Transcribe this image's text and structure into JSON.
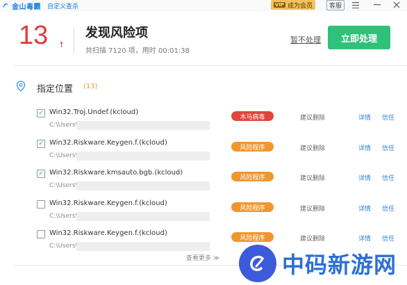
{
  "header": {
    "app_name": "金山毒霸",
    "app_subtitle": "自定义查杀",
    "vip_tag": "VIP",
    "vip_label": "成为会员",
    "service_label": "客服"
  },
  "summary": {
    "count": "13",
    "arrow": "↑",
    "title": "发现风险项",
    "subtitle": "共扫描 7120 项，用时 00:01:38",
    "ignore_label": "暂不处理",
    "fix_label": "立即处理"
  },
  "section": {
    "title": "指定位置",
    "count": "(13)"
  },
  "items": [
    {
      "name": "Win32.Troj.Undef.(kcloud)",
      "path": "C:\\Users\\",
      "badge": "木马病毒",
      "badge_color": "#e0453c",
      "advice": "建议删除",
      "detail": "详情",
      "trust": "信任",
      "checked": "✓"
    },
    {
      "name": "Win32.Riskware.Keygen.f.(kcloud)",
      "path": "C:\\Users\\",
      "badge": "风险程序",
      "badge_color": "#f0962e",
      "advice": "建议删除",
      "detail": "详情",
      "trust": "信任",
      "checked": "✓"
    },
    {
      "name": "Win32.Riskware.kmsauto.bgb.(kcloud)",
      "path": "C:\\Users\\",
      "badge": "风险程序",
      "badge_color": "#f0962e",
      "advice": "建议删除",
      "detail": "详情",
      "trust": "信任",
      "checked": "✓"
    },
    {
      "name": "Win32.Riskware.Keygen.f.(kcloud)",
      "path": "C:\\Users\\",
      "badge": "风险程序",
      "badge_color": "#f0962e",
      "advice": "建议删除",
      "detail": "详情",
      "trust": "信任",
      "checked": ""
    },
    {
      "name": "Win32.Riskware.Keygen.f.(kcloud)",
      "path": "C:\\Users\\",
      "badge": "风险程序",
      "badge_color": "#f0962e",
      "advice": "建议删除",
      "detail": "详情",
      "trust": "信任",
      "checked": ""
    }
  ],
  "footer": {
    "more_label": "查看更多 ≫"
  },
  "watermark": {
    "text": "中码新游网"
  },
  "colors": {
    "accent": "#2fc17a",
    "risk_count": "#e23b3b",
    "link": "#2d7fd6"
  }
}
